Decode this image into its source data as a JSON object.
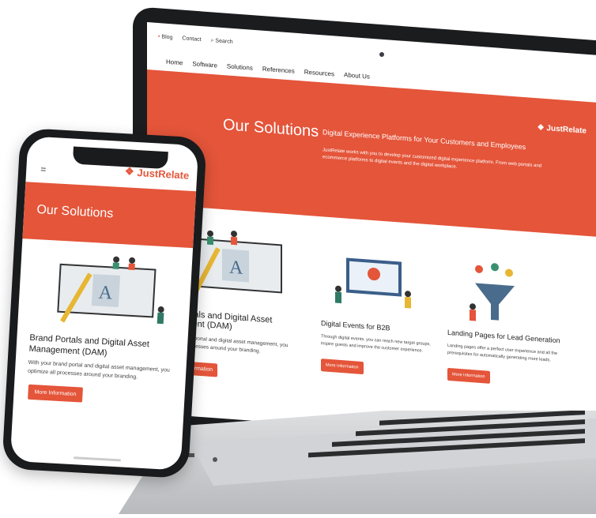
{
  "colors": {
    "accent": "#e4553a",
    "device": "#1b1c1e",
    "text": "#222222"
  },
  "laptop": {
    "utility_nav": [
      "Blog",
      "Contact",
      "Search"
    ],
    "utility_icons": [
      "dot-icon",
      "search-icon"
    ],
    "main_nav": [
      "Home",
      "Software",
      "Solutions",
      "References",
      "Resources",
      "About Us"
    ],
    "logo_text": "JustRelate",
    "hero": {
      "title": "Our Solutions",
      "subtitle": "Digital Experience Platforms for Your Customers and Employees",
      "text": "JustRelate works with you to develop your customized digital experience platform. From web portals and ecommerce platforms to digital events and the digital workplace."
    },
    "cards": [
      {
        "title": "d Portals and Digital Asset\nagement (DAM)",
        "text": "our brand portal and digital asset management, you\nize all processes around your branding.",
        "button": "ore Information"
      },
      {
        "title": "Digital Events for B2B",
        "text": "Through digital events, you can reach new target groups, inspire guests and improve the customer experience.",
        "button": "More Information"
      },
      {
        "title": "Landing Pages for Lead Generation",
        "text": "Landing pages offer a perfect user experience and all the prerequisites for automatically generating more leads.",
        "button": "More Information"
      }
    ]
  },
  "phone": {
    "menu_icon": "menu-icon",
    "logo_text": "JustRelate",
    "hero_title": "Our Solutions",
    "card": {
      "title": "Brand Portals and Digital Asset Management (DAM)",
      "text": "With your brand portal and digital asset management, you optimize all processes around your branding.",
      "button": "More Information"
    }
  }
}
